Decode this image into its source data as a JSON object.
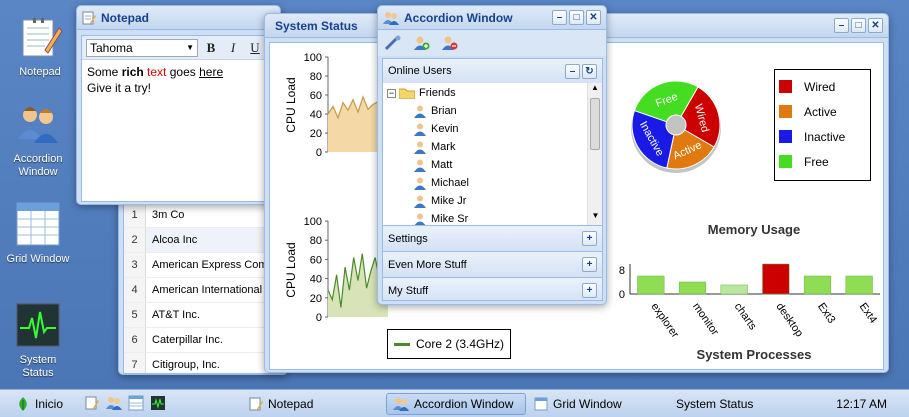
{
  "desktop": {
    "shortcuts": [
      {
        "label": "Notepad"
      },
      {
        "label": "Accordion Window"
      },
      {
        "label": "Grid Window"
      },
      {
        "label": "System Status"
      }
    ]
  },
  "grid_window": {
    "rows": [
      {
        "num": "1",
        "name": "3m Co"
      },
      {
        "num": "2",
        "name": "Alcoa Inc"
      },
      {
        "num": "3",
        "name": "American Express Comp"
      },
      {
        "num": "4",
        "name": "American International"
      },
      {
        "num": "5",
        "name": "AT&T Inc."
      },
      {
        "num": "6",
        "name": "Caterpillar Inc."
      },
      {
        "num": "7",
        "name": "Citigroup, Inc."
      }
    ]
  },
  "notepad": {
    "title": "Notepad",
    "font": "Tahoma",
    "format_buttons": [
      "B",
      "I",
      "U"
    ],
    "text_line1": {
      "a": "Some ",
      "b": "rich",
      "c": " ",
      "d": "text",
      "e": " goes ",
      "f": "here"
    },
    "text_line2": "Give it a try!"
  },
  "system_status": {
    "title": "System Status",
    "cpu_chart_1": {
      "ylabel": "CPU Load",
      "ticks": [
        "100",
        "80",
        "60",
        "40",
        "20",
        "0"
      ]
    },
    "cpu_chart_2": {
      "ylabel": "CPU Load",
      "ticks": [
        "100",
        "80",
        "60",
        "40",
        "20",
        "0"
      ],
      "legend": "Core 2 (3.4GHz)"
    },
    "colors": {
      "wired": "#cc0000",
      "active": "#e07a10",
      "inactive": "#1a1ae6",
      "free": "#44dd22",
      "cpu1_fill": "#f4d9a6",
      "cpu2_fill": "#d8e4b8"
    }
  },
  "chart_data": [
    {
      "type": "line",
      "title": "",
      "ylabel": "CPU Load",
      "ylim": [
        0,
        100
      ],
      "series": [
        {
          "values": [
            40,
            48,
            36,
            52,
            44,
            55,
            42,
            58,
            45,
            50,
            53
          ]
        }
      ]
    },
    {
      "type": "pie",
      "categories": [
        "Wired",
        "Active",
        "Inactive",
        "Free"
      ],
      "values": [
        25,
        20,
        27,
        28
      ],
      "title": "Memory Usage"
    },
    {
      "type": "line",
      "ylabel": "CPU Load",
      "ylim": [
        0,
        100
      ],
      "series": [
        {
          "name": "Core 2 (3.4GHz)",
          "values": [
            28,
            18,
            44,
            10,
            52,
            28,
            62,
            38,
            66,
            30,
            48,
            62,
            40,
            58,
            70
          ]
        }
      ]
    },
    {
      "type": "bar",
      "title": "System Processes",
      "categories": [
        "explorer",
        "monitor",
        "charts",
        "desktop",
        "Ext3",
        "Ext4"
      ],
      "values": [
        6,
        4,
        3,
        10,
        6,
        6
      ],
      "yticks": [
        "8",
        "0"
      ]
    }
  ],
  "accordion": {
    "title": "Accordion Window",
    "online_users_label": "Online Users",
    "tree_root": "Friends",
    "users": [
      "Brian",
      "Kevin",
      "Mark",
      "Matt",
      "Michael",
      "Mike Jr",
      "Mike Sr"
    ],
    "panels": [
      "Settings",
      "Even More Stuff",
      "My Stuff"
    ]
  },
  "taskbar": {
    "start_label": "Inicio",
    "items": [
      "Notepad",
      "Accordion Window",
      "Grid Window",
      "System Status"
    ],
    "clock": "12:17 AM"
  }
}
